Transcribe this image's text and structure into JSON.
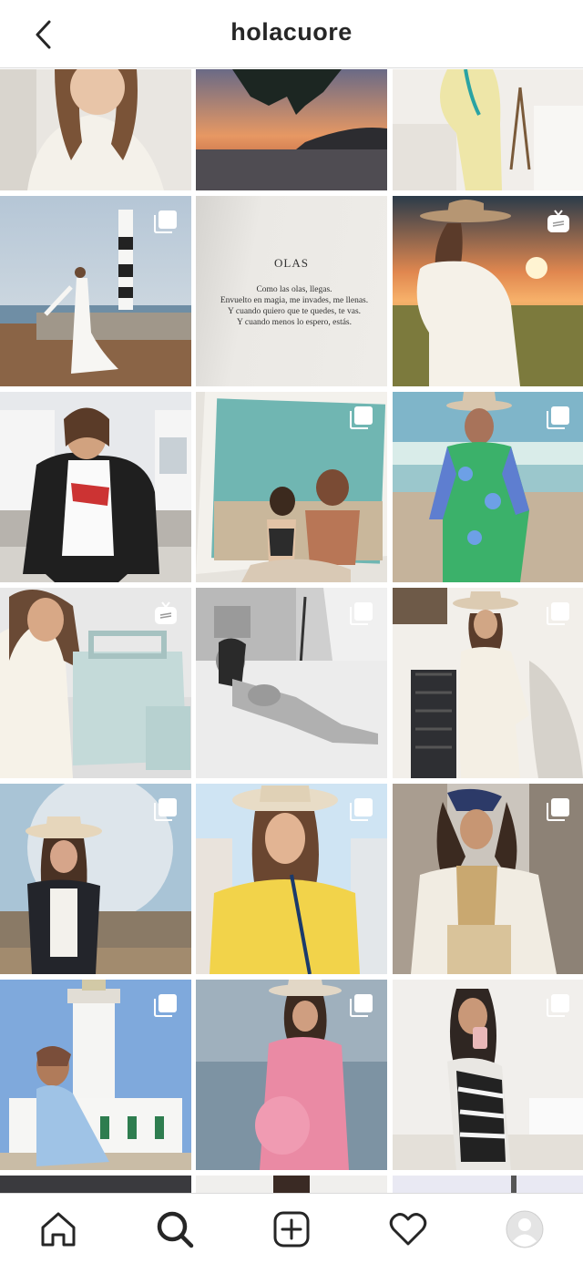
{
  "header": {
    "username": "holacuore",
    "back_icon": "chevron-left-icon"
  },
  "grid": {
    "book_page": {
      "title": "OLAS",
      "lines": [
        "Como las olas, llegas.",
        "Envuelto en magia, me invades, me llenas.",
        "Y cuando quiero que te  quedes, te vas.",
        "Y cuando menos lo espero, estás."
      ]
    },
    "overlay_icons": {
      "carousel": "multiple-posts-icon",
      "igtv": "igtv-icon"
    }
  },
  "bottom_nav": {
    "items": [
      "home-icon",
      "search-icon",
      "new-post-icon",
      "activity-heart-icon",
      "profile-avatar"
    ],
    "active": "search-icon"
  },
  "colors": {
    "text": "#262626",
    "divider": "#dbdbdb",
    "background": "#ffffff"
  }
}
